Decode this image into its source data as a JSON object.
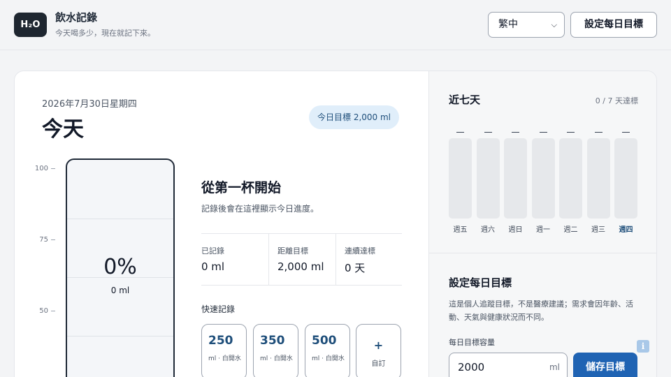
{
  "app": {
    "logo_text": "H₂O",
    "title": "飲水記錄",
    "subtitle": "今天喝多少，現在就記下來。"
  },
  "header": {
    "language_selected": "繁中",
    "set_goal_button": "設定每日目標"
  },
  "today": {
    "date": "2026年7月30日星期四",
    "heading": "今天",
    "goal_pill": "今日目標 2,000 ml"
  },
  "glass": {
    "axis_ticks": [
      "100",
      "75",
      "50"
    ],
    "percent": "0%",
    "amount": "0 ml",
    "fill_fraction": 0
  },
  "empty_state": {
    "title": "從第一杯開始",
    "subtitle": "記錄後會在這裡顯示今日進度。"
  },
  "stats": [
    {
      "label": "已記錄",
      "value": "0 ml"
    },
    {
      "label": "距離目標",
      "value": "2,000 ml"
    },
    {
      "label": "連續達標",
      "value": "0 天"
    }
  ],
  "quick_log": {
    "title": "快速記錄",
    "buttons": [
      {
        "amount": "250",
        "label": "ml · 白開水"
      },
      {
        "amount": "350",
        "label": "ml · 白開水"
      },
      {
        "amount": "500",
        "label": "ml · 白開水"
      }
    ],
    "custom_plus": "+",
    "custom_label": "自訂"
  },
  "week": {
    "title": "近七天",
    "count": "0 / 7 天達標",
    "days": [
      {
        "label": "週五",
        "value": "—",
        "active": false
      },
      {
        "label": "週六",
        "value": "—",
        "active": false
      },
      {
        "label": "週日",
        "value": "—",
        "active": false
      },
      {
        "label": "週一",
        "value": "—",
        "active": false
      },
      {
        "label": "週二",
        "value": "—",
        "active": false
      },
      {
        "label": "週三",
        "value": "—",
        "active": false
      },
      {
        "label": "週四",
        "value": "—",
        "active": true
      }
    ]
  },
  "goal_form": {
    "title": "設定每日目標",
    "description": "這是個人追蹤目標，不是醫療建議；需求會因年齡、活動、天氣與健康狀況而不同。",
    "capacity_label": "每日目標容量",
    "capacity_value": "2000",
    "capacity_unit": "ml",
    "save_button": "儲存目標"
  },
  "info_icon_text": "i",
  "colors": {
    "accent": "#1f63b3",
    "accent_dark": "#1e4e7a",
    "pill_bg": "#e0eefa",
    "logo_bg": "#1e2630"
  }
}
